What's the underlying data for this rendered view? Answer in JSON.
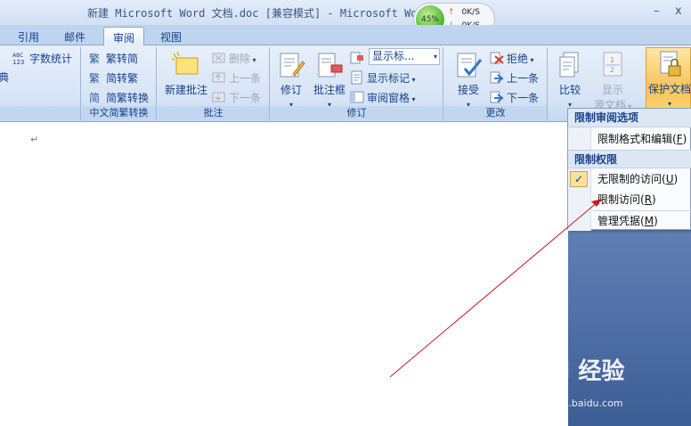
{
  "title_bar": {
    "title": "新建 Microsoft Word 文档.doc [兼容模式] - Microsoft Word",
    "minimize": "–",
    "close": "x"
  },
  "net_widget": {
    "percent": "45%",
    "up_rate": "0K/S",
    "down_rate": "0K/S"
  },
  "tabs": [
    {
      "label": "引用"
    },
    {
      "label": "邮件"
    },
    {
      "label": "审阅"
    },
    {
      "label": "视图"
    }
  ],
  "ribbon": {
    "proofing": {
      "cut_text": "典",
      "word_count": "字数统计"
    },
    "chinese": {
      "trad": "繁转简",
      "simp": "简转繁",
      "convert": "简繁转换",
      "label": "中文简繁转换"
    },
    "comments": {
      "new": "新建批注",
      "delete": "删除",
      "prev": "上一条",
      "next": "下一条",
      "label": "批注"
    },
    "tracking": {
      "track": "修订",
      "balloon": "批注框",
      "display": "显示标...",
      "show_markup": "显示标记",
      "pane": "审阅窗格",
      "label": "修订"
    },
    "changes": {
      "accept": "接受",
      "reject": "拒绝",
      "prev": "上一条",
      "next": "下一条",
      "label": "更改"
    },
    "compare": {
      "compare": "比较",
      "source_line1": "显示",
      "source_line2": "源文档",
      "protect": "保护文档"
    }
  },
  "menu": {
    "header1": "限制审阅选项",
    "item1": "限制格式和编辑",
    "item1_key": "F",
    "header2": "限制权限",
    "item2": "无限制的访问",
    "item2_key": "U",
    "item3": "限制访问",
    "item3_key": "R",
    "item4": "管理凭据",
    "item4_key": "M",
    "check": "✓"
  },
  "document": {
    "pilcrow": "↵"
  },
  "watermark": {
    "brand": "Bai 经验",
    "url": "jingyan.baidu.com"
  }
}
